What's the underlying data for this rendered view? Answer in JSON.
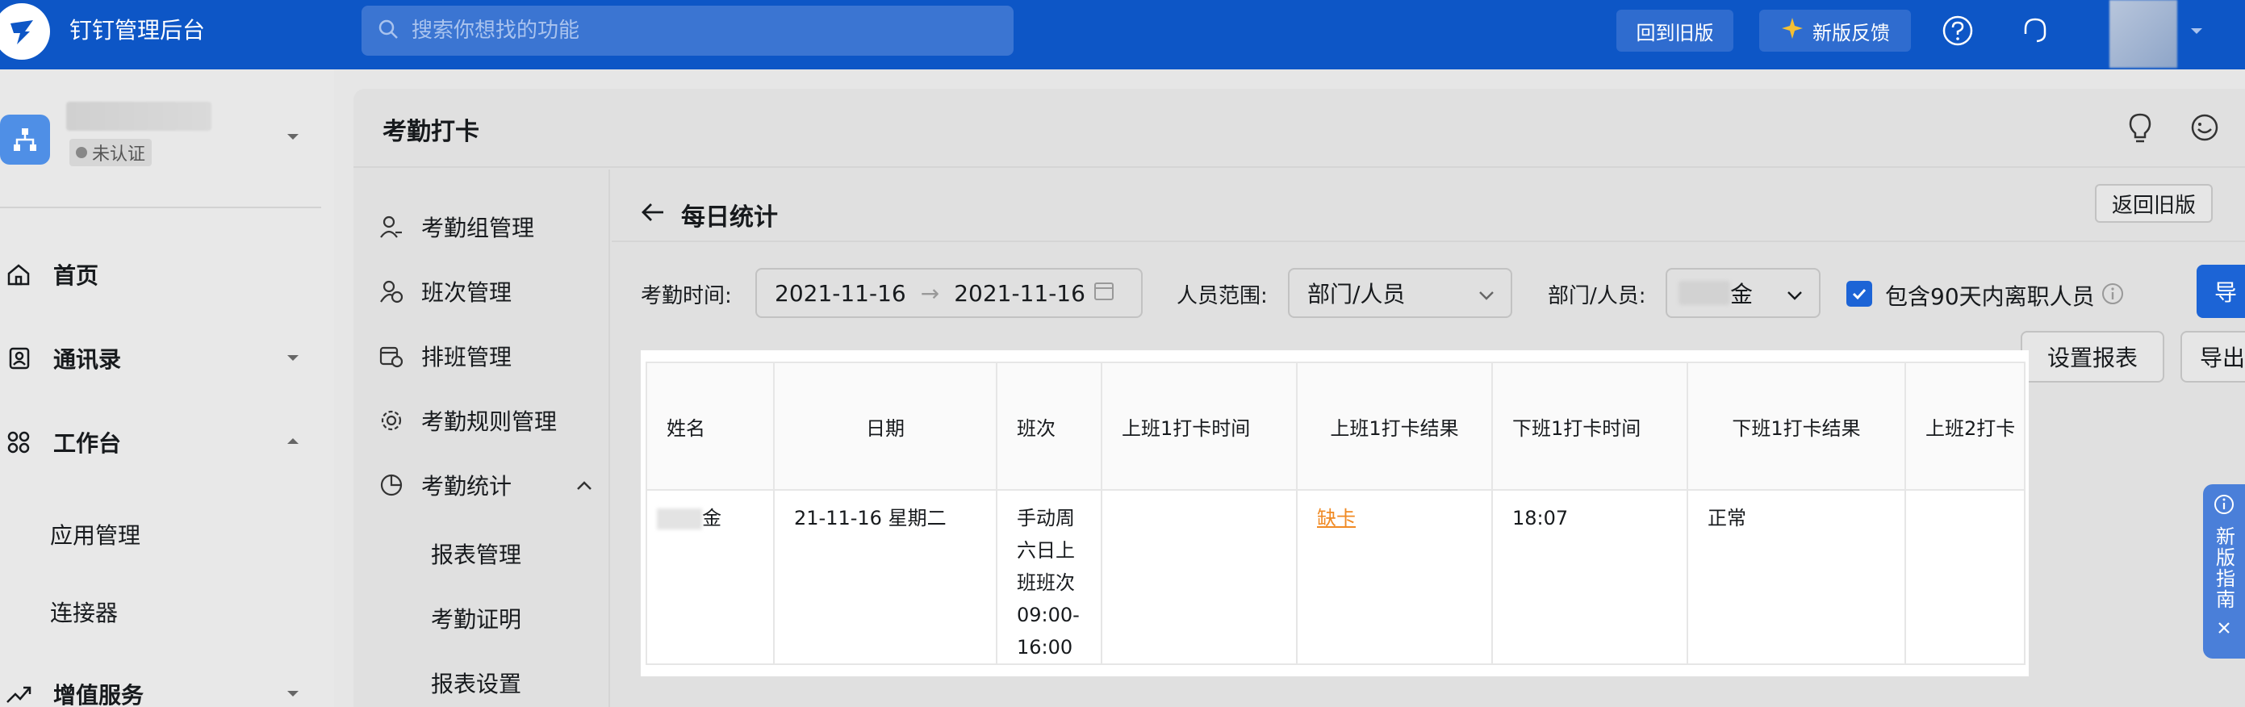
{
  "topbar": {
    "app_title": "钉钉管理后台",
    "search_placeholder": "搜索你想找的功能",
    "old_version_btn": "回到旧版",
    "feedback_btn": "新版反馈"
  },
  "sidebar": {
    "org_status": "未认证",
    "nav": [
      {
        "label": "首页"
      },
      {
        "label": "通讯录"
      },
      {
        "label": "工作台"
      },
      {
        "label": "增值服务"
      }
    ],
    "workbench_children": [
      "应用管理",
      "连接器"
    ]
  },
  "panel": {
    "title": "考勤打卡",
    "submenu": [
      {
        "label": "考勤组管理"
      },
      {
        "label": "班次管理"
      },
      {
        "label": "排班管理"
      },
      {
        "label": "考勤规则管理"
      },
      {
        "label": "考勤统计"
      }
    ],
    "stats_children": [
      "报表管理",
      "考勤证明",
      "报表设置"
    ]
  },
  "main": {
    "page_title": "每日统计",
    "return_old_btn": "返回旧版",
    "filters": {
      "time_label": "考勤时间:",
      "date_start": "2021-11-16",
      "date_end": "2021-11-16",
      "date_sep": "→",
      "scope_label": "人员范围:",
      "scope_value": "部门/人员",
      "dept_label": "部门/人员:",
      "dept_value_suffix": "金",
      "include_left_label": "包含90天内离职人员",
      "export_blue": "导",
      "set_report_btn": "设置报表",
      "export_btn": "导出"
    }
  },
  "table": {
    "columns": [
      "姓名",
      "日期",
      "班次",
      "上班1打卡时间",
      "上班1打卡结果",
      "下班1打卡时间",
      "下班1打卡结果",
      "上班2打卡"
    ],
    "rows": [
      {
        "name_suffix": "金",
        "date": "21-11-16 星期二",
        "shift_lines": [
          "手动周",
          "六日上",
          "班班次",
          "09:00-",
          "16:00"
        ],
        "in1_time": "",
        "in1_result": "缺卡",
        "out1_time": "18:07",
        "out1_result": "正常",
        "in2_time": ""
      }
    ]
  },
  "guide": {
    "text": "新版指南"
  },
  "colors": {
    "brand_blue": "#0d56c6",
    "primary": "#1c64d6",
    "warning_orange": "#f08a24"
  }
}
